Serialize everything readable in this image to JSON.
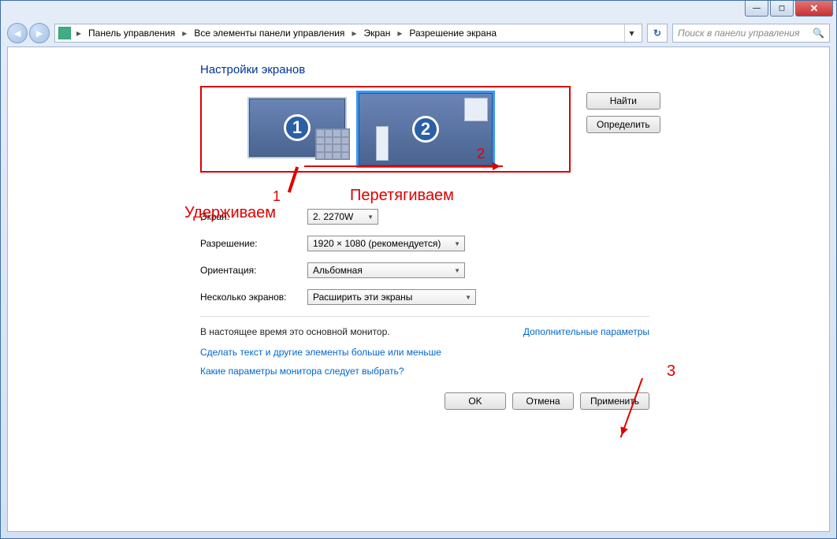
{
  "breadcrumbs": {
    "p0": "Панель управления",
    "p1": "Все элементы панели управления",
    "p2": "Экран",
    "p3": "Разрешение экрана"
  },
  "search": {
    "placeholder": "Поиск в панели управления"
  },
  "page": {
    "title": "Настройки экранов"
  },
  "preview": {
    "monitor1_num": "1",
    "monitor2_num": "2",
    "monitor2_label": "2",
    "btn_find": "Найти",
    "btn_identify": "Определить"
  },
  "annotations": {
    "num1": "1",
    "hold": "Удерживаем",
    "drag": "Перетягиваем",
    "num3": "3"
  },
  "form": {
    "display_label": "Экран:",
    "display_value": "2. 2270W",
    "resolution_label": "Разрешение:",
    "resolution_value": "1920 × 1080 (рекомендуется)",
    "orientation_label": "Ориентация:",
    "orientation_value": "Альбомная",
    "multi_label": "Несколько экранов:",
    "multi_value": "Расширить эти экраны"
  },
  "info": {
    "primary_text": "В настоящее время это основной монитор.",
    "adv_link": "Дополнительные параметры",
    "link_bigger": "Сделать текст и другие элементы больше или меньше",
    "link_which": "Какие параметры монитора следует выбрать?"
  },
  "actions": {
    "ok": "OK",
    "cancel": "Отмена",
    "apply": "Применить"
  }
}
